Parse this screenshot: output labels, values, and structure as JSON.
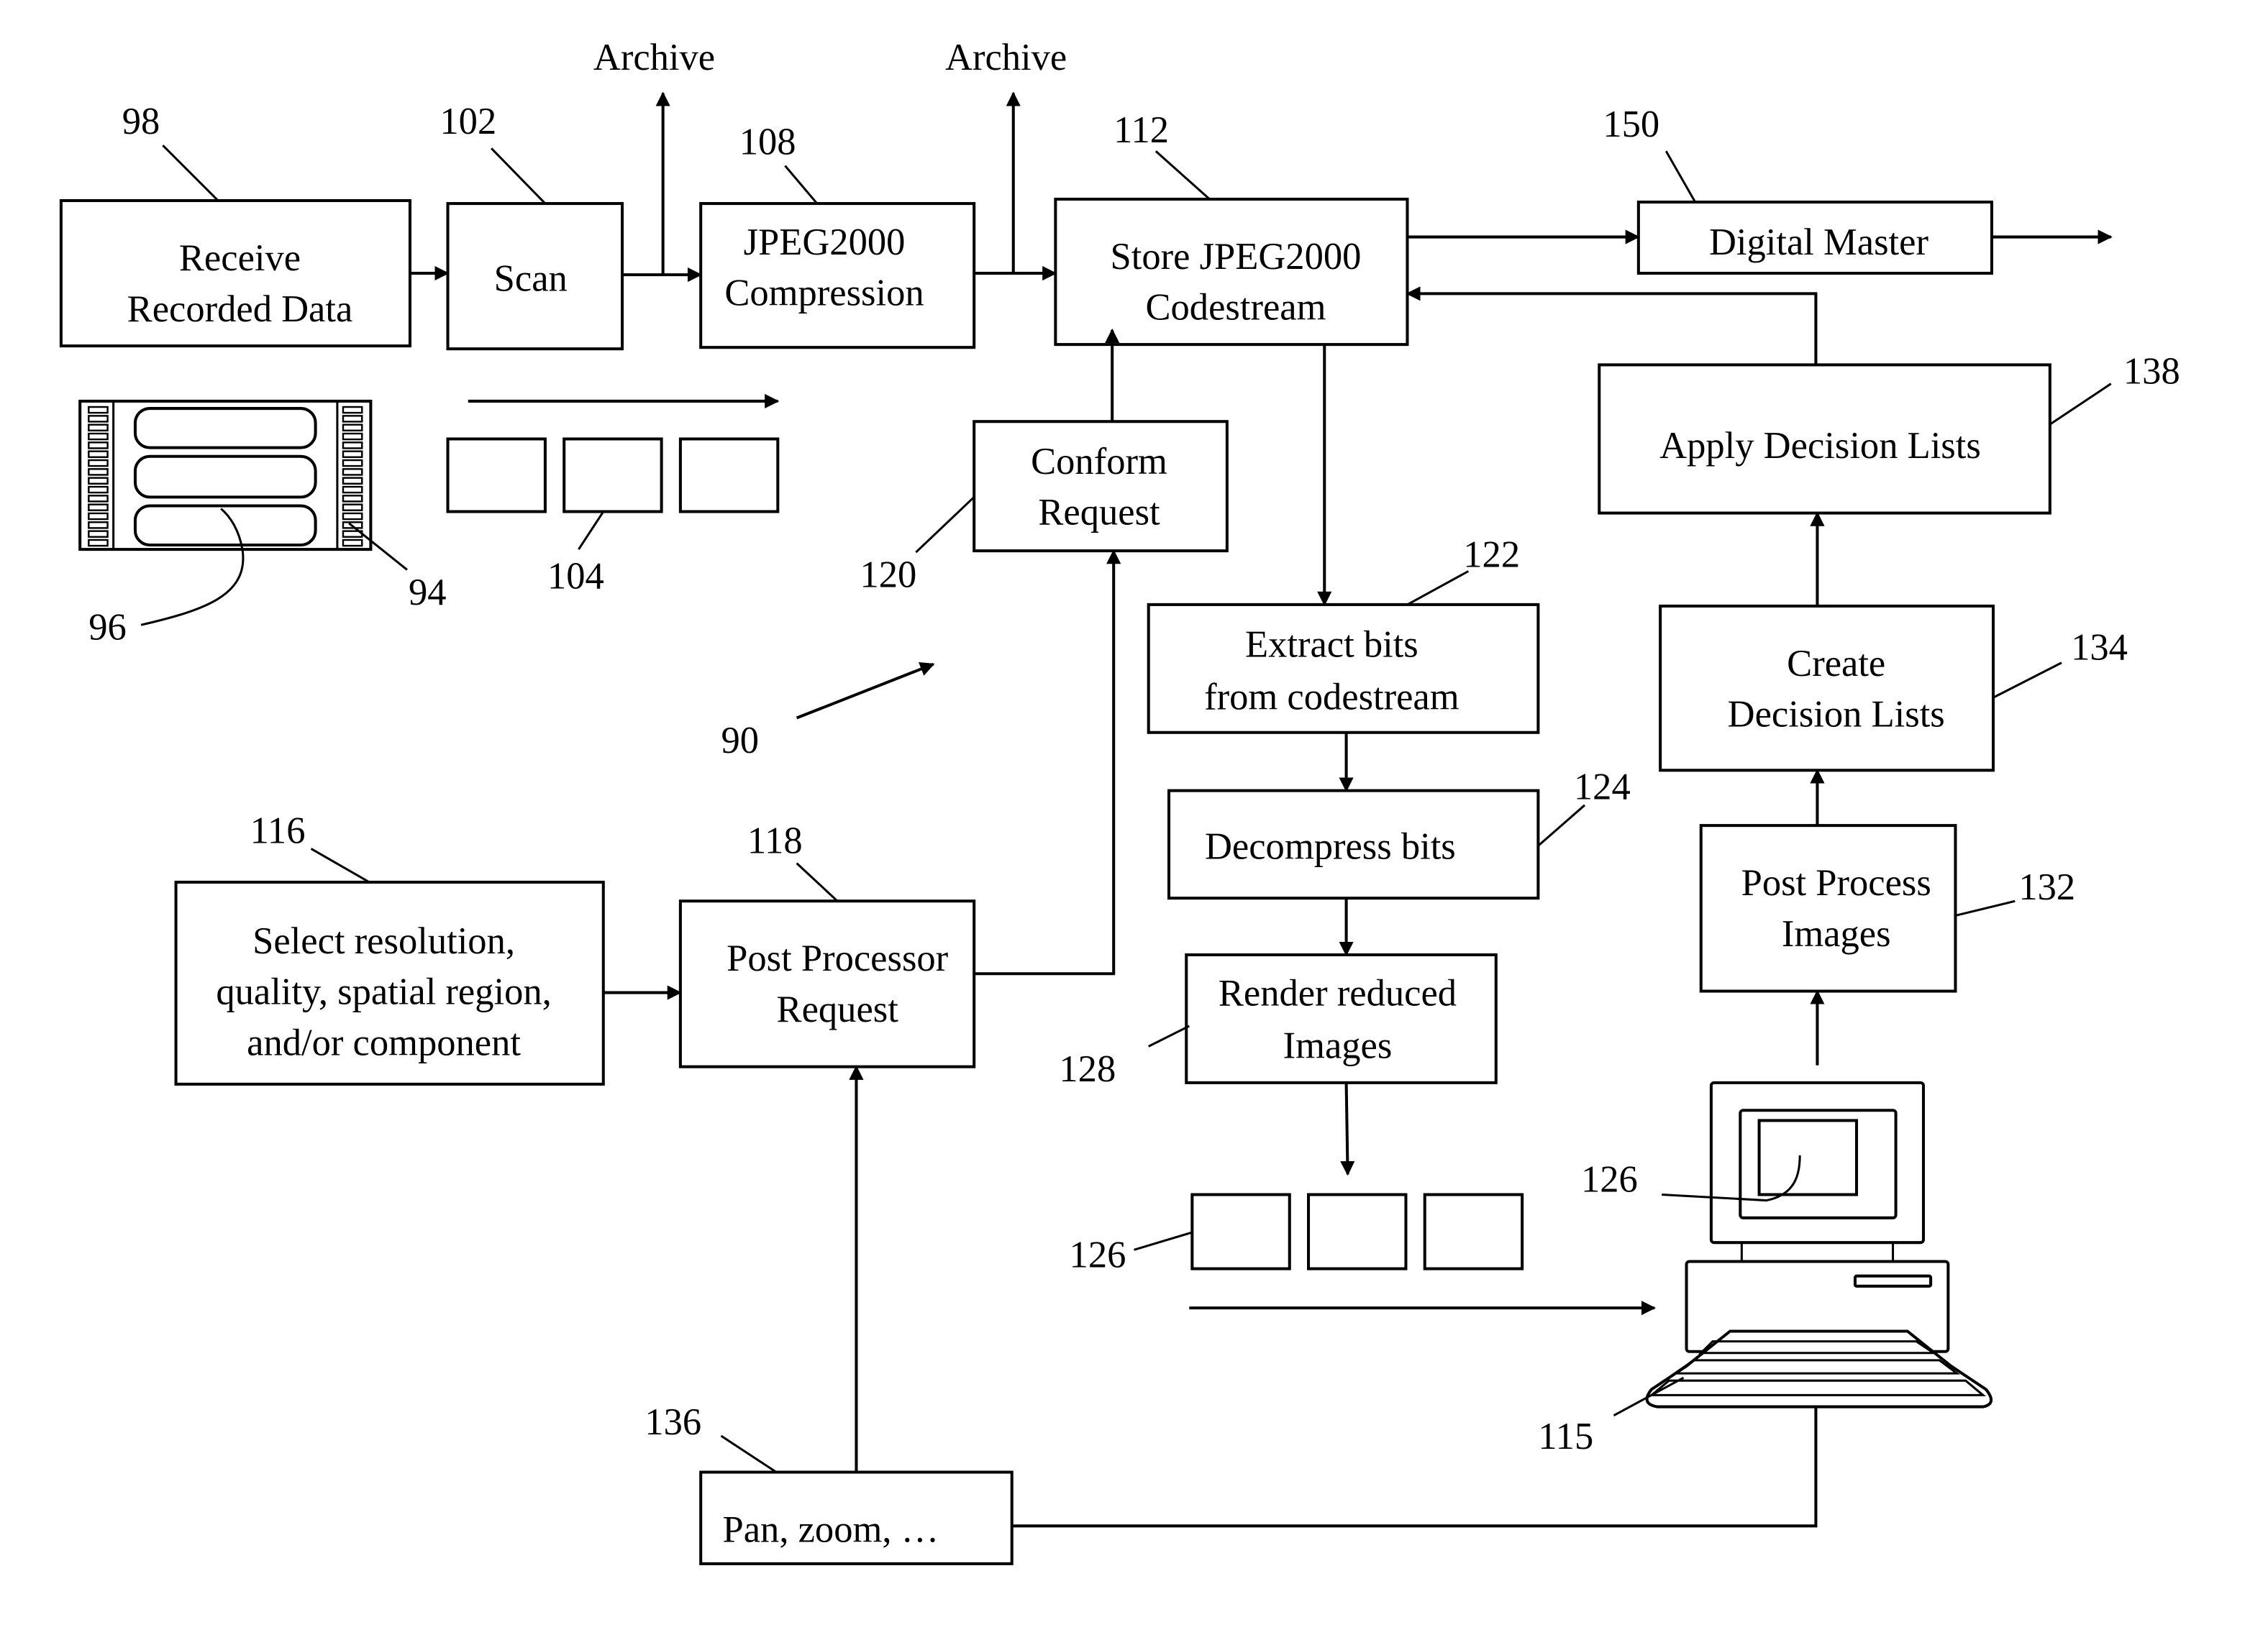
{
  "figure": {
    "type": "patent flowchart",
    "reference": "90",
    "line_color": "#000000",
    "background": "#ffffff"
  },
  "boxes": {
    "receive": {
      "ref": "98",
      "lines": [
        "Receive",
        "Recorded Data"
      ]
    },
    "scan": {
      "ref": "102",
      "lines": [
        "Scan"
      ]
    },
    "jpeg_compress": {
      "ref": "108",
      "lines": [
        "JPEG2000",
        "Compression"
      ]
    },
    "store": {
      "ref": "112",
      "lines": [
        "Store JPEG2000",
        "Codestream"
      ]
    },
    "digital_master": {
      "ref": "150",
      "lines": [
        "Digital Master"
      ]
    },
    "apply_decision": {
      "ref": "138",
      "lines": [
        "Apply Decision Lists"
      ]
    },
    "conform": {
      "ref": "120",
      "lines": [
        "Conform",
        "Request"
      ]
    },
    "extract": {
      "ref": "122",
      "lines": [
        "Extract bits",
        "from codestream"
      ]
    },
    "create_decision": {
      "ref": "134",
      "lines": [
        "Create",
        "Decision Lists"
      ]
    },
    "decompress": {
      "ref": "124",
      "lines": [
        "Decompress bits"
      ]
    },
    "select": {
      "ref": "116",
      "lines": [
        "Select resolution,",
        "quality, spatial region,",
        "and/or component"
      ]
    },
    "post_request": {
      "ref": "118",
      "lines": [
        "Post Processor",
        "Request"
      ]
    },
    "post_process": {
      "ref": "132",
      "lines": [
        "Post Process",
        "Images"
      ]
    },
    "render": {
      "ref": "128",
      "lines": [
        "Render reduced",
        "Images"
      ]
    },
    "pan_zoom": {
      "ref": "136",
      "lines": [
        "Pan, zoom, …"
      ]
    }
  },
  "labels": {
    "archive_1": "Archive",
    "archive_2": "Archive",
    "film_ref": "94",
    "frame_ref": "96",
    "scanned_frames_ref": "104",
    "reduced_images_ref": "126",
    "screen_image_ref": "126",
    "workstation_ref": "115",
    "system_ref": "90"
  }
}
